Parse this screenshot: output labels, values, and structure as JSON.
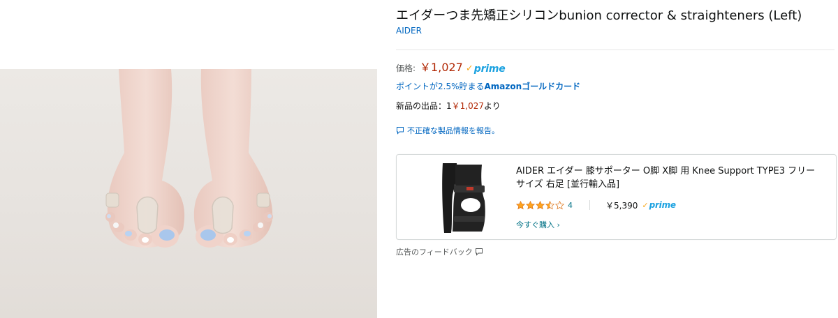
{
  "product": {
    "title": "エイダーつま先矯正シリコンbunion corrector & straighteners (Left)",
    "brand": "AIDER",
    "price_label": "価格:",
    "price": "￥1,027",
    "prime_text": "prime",
    "points_prefix": "ポイントが2.5%貯まる",
    "points_card": "Amazonゴールドカード",
    "new_offers_prefix": "新品の出品：1",
    "new_offers_price": "￥1,027",
    "new_offers_suffix": "より",
    "report_link": "不正確な製品情報を報告。"
  },
  "ad": {
    "title": "AIDER エイダー 膝サポーター O脚 X脚 用 Knee Support TYPE3 フリーサイズ 右足 [並行輸入品]",
    "rating": 3.5,
    "rating_count": "4",
    "price": "￥5,390",
    "prime_text": "prime",
    "shop_now": "今すぐ購入 ›",
    "feedback_label": "広告のフィードバック"
  },
  "colors": {
    "link": "#0066c0",
    "price": "#b12704",
    "prime_blue": "#1aa1e0",
    "prime_check": "#f7a81b",
    "star": "#ffa41c"
  }
}
